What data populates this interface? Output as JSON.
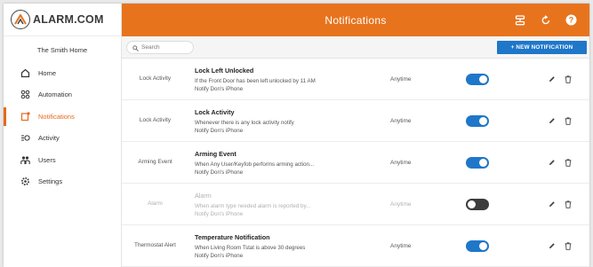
{
  "brand": {
    "logo_text": "ALARM.COM"
  },
  "sidebar": {
    "home_name": "The Smith Home",
    "items": [
      {
        "label": "Home",
        "icon": "home-icon"
      },
      {
        "label": "Automation",
        "icon": "automation-icon"
      },
      {
        "label": "Notifications",
        "icon": "notifications-icon",
        "active": true
      },
      {
        "label": "Activity",
        "icon": "activity-icon"
      },
      {
        "label": "Users",
        "icon": "users-icon"
      },
      {
        "label": "Settings",
        "icon": "settings-icon"
      }
    ]
  },
  "header": {
    "title": "Notifications",
    "icons": [
      "server-icon",
      "refresh-icon",
      "help-icon"
    ]
  },
  "toolbar": {
    "search_placeholder": "Search",
    "new_button": "+ NEW NOTIFICATION"
  },
  "colors": {
    "accent": "#e8731d",
    "primary": "#1f77c9",
    "toggle_off": "#3d3d3d"
  },
  "notifications": [
    {
      "category": "Lock Activity",
      "title": "Lock Left Unlocked",
      "desc1": "If the Front Door has been left unlocked by 11 AM",
      "desc2": "Notify Don's iPhone",
      "time": "Anytime",
      "enabled": true
    },
    {
      "category": "Lock Activity",
      "title": "Lock Activity",
      "desc1": "Whenever there is any lock activity notify",
      "desc2": "Notify Don's iPhone",
      "time": "Anytime",
      "enabled": true
    },
    {
      "category": "Arming Event",
      "title": "Arming Event",
      "desc1": "When Any User/Keyfob performs arming action...",
      "desc2": "Notify Don's iPhone",
      "time": "Anytime",
      "enabled": true
    },
    {
      "category": "Alarm",
      "title": "Alarm",
      "desc1": "When alarm type needed alarm is reported by...",
      "desc2": "Notify Don's iPhone",
      "time": "Anytime",
      "enabled": false
    },
    {
      "category": "Thermostat Alert",
      "title": "Temperature Notification",
      "desc1": "When Living Room Tstat is above 30 degrees",
      "desc2": "Notify Don's iPhone",
      "time": "Anytime",
      "enabled": true
    }
  ]
}
